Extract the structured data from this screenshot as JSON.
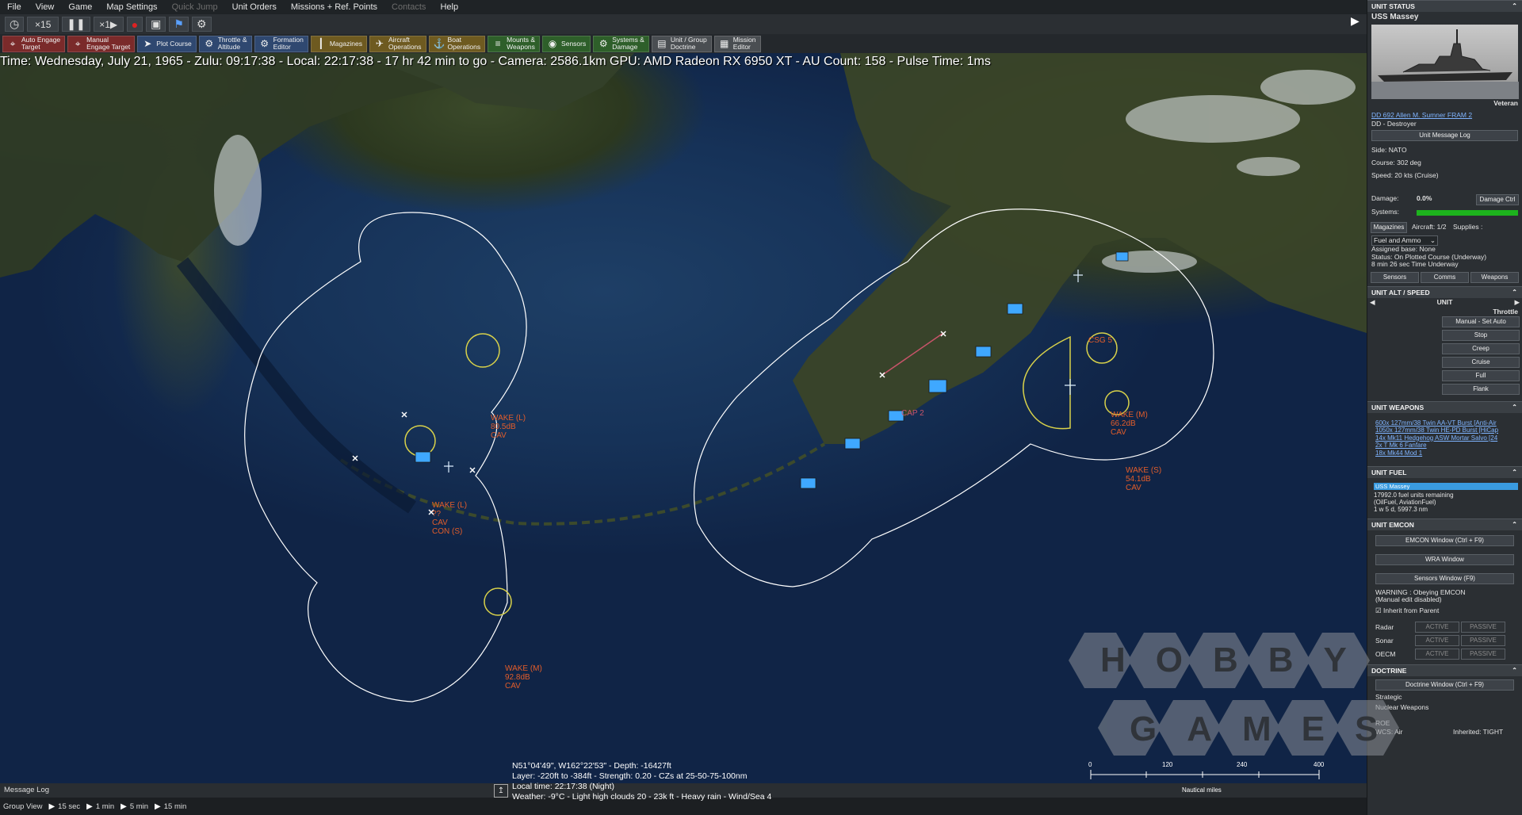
{
  "menu": {
    "items": [
      {
        "label": "File",
        "enabled": true
      },
      {
        "label": "View",
        "enabled": true
      },
      {
        "label": "Game",
        "enabled": true
      },
      {
        "label": "Map Settings",
        "enabled": true
      },
      {
        "label": "Quick Jump",
        "enabled": false
      },
      {
        "label": "Unit Orders",
        "enabled": true
      },
      {
        "label": "Missions + Ref. Points",
        "enabled": true
      },
      {
        "label": "Contacts",
        "enabled": false
      },
      {
        "label": "Help",
        "enabled": true
      }
    ]
  },
  "toolbar": {
    "clock_icon": "clock-icon",
    "compression": "×15",
    "pause_icon": "pause-icon",
    "single_step": "×1",
    "record_icon": "record-icon"
  },
  "commands": [
    {
      "label": "Auto Engage\nTarget",
      "icon": "crosshair-icon",
      "color": "#7a2a2a"
    },
    {
      "label": "Manual\nEngage Target",
      "icon": "crosshair-manual-icon",
      "color": "#7a2a2a"
    },
    {
      "label": "Plot Course",
      "icon": "course-icon",
      "color": "#2f4870"
    },
    {
      "label": "Throttle &\nAltitude",
      "icon": "throttle-icon",
      "color": "#2f4870"
    },
    {
      "label": "Formation\nEditor",
      "icon": "formation-icon",
      "color": "#2f4870"
    },
    {
      "label": "Magazines",
      "icon": "magazine-icon",
      "color": "#6e5a20"
    },
    {
      "label": "Aircraft\nOperations",
      "icon": "aircraft-icon",
      "color": "#6e5a20"
    },
    {
      "label": "Boat\nOperations",
      "icon": "boat-icon",
      "color": "#6e5a20"
    },
    {
      "label": "Mounts &\nWeapons",
      "icon": "mounts-icon",
      "color": "#2e5f2a"
    },
    {
      "label": "Sensors",
      "icon": "sensors-icon",
      "color": "#2e5f2a"
    },
    {
      "label": "Systems &\nDamage",
      "icon": "systems-icon",
      "color": "#2e5f2a"
    },
    {
      "label": "Unit / Group\nDoctrine",
      "icon": "doctrine-icon",
      "color": "#4a4e52"
    },
    {
      "label": "Mission\nEditor",
      "icon": "mission-icon",
      "color": "#4a4e52"
    }
  ],
  "status_line": "Time: Wednesday, July 21, 1965 - Zulu: 09:17:38 - Local: 22:17:38 - 17 hr 42 min to go - Camera: 2586.1km GPU: AMD Radeon RX 6950 XT - AU Count: 158 - Pulse Time: 1ms",
  "map": {
    "contacts": [
      {
        "label": "WAKE (L)\n80.5dB\nCAV"
      },
      {
        "label": "WAKE (L)\n??\nCAV\nCON (S)"
      },
      {
        "label": "WAKE (M)\n92.8dB\nCAV"
      },
      {
        "label": "WAKE (M)\n66.2dB\nCAV"
      },
      {
        "label": "WAKE (S)\n54.1dB\nCAV"
      },
      {
        "label": "CAP 2"
      },
      {
        "label": "CSG 5"
      }
    ]
  },
  "cursor_info": {
    "line1": "N51°04'49\", W162°22'53\" - Depth: -16427ft",
    "line2": "Layer: -220ft to -384ft - Strength: 0.20 - CZs at 25-50-75-100nm",
    "line3": "Local time: 22:17:38 (Night)",
    "line4": "Weather: -9°C - Light high clouds 20 - 23k ft - Heavy rain - Wind/Sea 4"
  },
  "scale": {
    "ticks": [
      "0",
      "120",
      "240",
      "400"
    ],
    "unit": "Nautical miles"
  },
  "message_log": "Message Log",
  "group_view": {
    "label": "Group View",
    "steps": [
      "15 sec",
      "1 min",
      "5 min",
      "15 min"
    ]
  },
  "panel": {
    "unit_status": {
      "header": "UNIT STATUS",
      "name": "USS Massey",
      "proficiency": "Veteran",
      "class_link": "DD 692 Allen M. Sumner FRAM 2",
      "type": "DD - Destroyer",
      "msg_log_btn": "Unit Message Log",
      "side": "Side: NATO",
      "course": "Course: 302 deg",
      "speed": "Speed: 20 kts (Cruise)",
      "damage_label": "Damage:",
      "damage_value": "0.0%",
      "damage_btn": "Damage Ctrl",
      "systems_label": "Systems:",
      "magazines_btn": "Magazines",
      "aircraft": "Aircraft: 1/2",
      "supplies": "Supplies :",
      "fuel_select": "Fuel and Ammo",
      "assigned_base": "Assigned base: None",
      "status": "Status: On Plotted Course (Underway)",
      "time_underway": "8 min 26 sec Time Underway",
      "tabs": [
        "Sensors",
        "Comms",
        "Weapons"
      ]
    },
    "alt_speed": {
      "header": "UNIT ALT / SPEED",
      "sub": "UNIT",
      "throttle": "Throttle",
      "manual_btn": "Manual - Set Auto",
      "speeds": [
        "Stop",
        "Creep",
        "Cruise",
        "Full",
        "Flank"
      ]
    },
    "weapons": {
      "header": "UNIT WEAPONS",
      "items": [
        "600x 127mm/38 Twin AA-VT Burst [Anti-Air",
        "1050x 127mm/38 Twin HE-PD Burst [HiCap",
        "14x Mk11 Hedgehog ASW Mortar Salvo [24",
        "2x T Mk 6 Fanfare",
        "18x Mk44 Mod 1"
      ]
    },
    "fuel": {
      "header": "UNIT FUEL",
      "bar_label": "USS Massey",
      "remaining": "17992.0 fuel units remaining",
      "type": "(OilFuel, AviationFuel)",
      "endurance": "1 w 5 d, 5997.3 nm"
    },
    "emcon": {
      "header": "UNIT EMCON",
      "emcon_btn": "EMCON Window (Ctrl + F9)",
      "wra_btn": "WRA Window",
      "sensors_btn": "Sensors Window (F9)",
      "warning": "WARNING : Obeying EMCON",
      "warning2": "(Manual edit disabled)",
      "inherit": "Inherit from Parent",
      "rows": [
        {
          "name": "Radar",
          "active": "ACTIVE",
          "passive": "PASSIVE"
        },
        {
          "name": "Sonar",
          "active": "ACTIVE",
          "passive": "PASSIVE"
        },
        {
          "name": "OECM",
          "active": "ACTIVE",
          "passive": "PASSIVE"
        }
      ]
    },
    "doctrine": {
      "header": "DOCTRINE",
      "doctrine_btn": "Doctrine Window (Ctrl + F9)",
      "strategic": "Strategic",
      "nuclear": "Nuclear Weapons",
      "roe": "ROE",
      "wcs": "WCS: Air",
      "wcs_value": "Inherited: TIGHT"
    }
  },
  "watermark": {
    "top": "HOBBY",
    "bottom": "GAMES"
  },
  "colors": {
    "accent_green": "#1db31d",
    "fuel_bar": "#3a9be0",
    "contact_text": "#e35d2a",
    "range_ring": "#ffffff",
    "contact_ring": "#d9d24a"
  }
}
